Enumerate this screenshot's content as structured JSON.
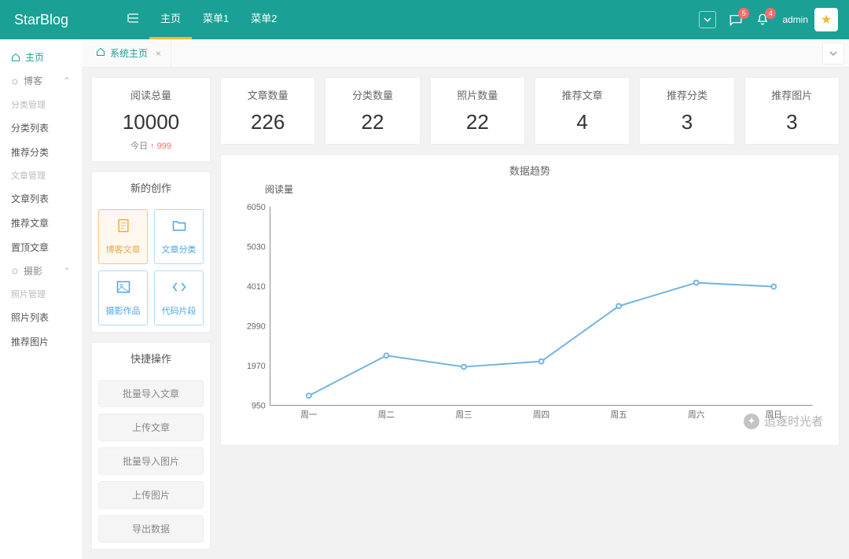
{
  "brand": "StarBlog",
  "top_menu": {
    "items": [
      "主页",
      "菜单1",
      "菜单2"
    ],
    "active": 0
  },
  "header": {
    "msg_badge": "5",
    "bell_badge": "4",
    "user": "admin"
  },
  "sidebar": {
    "home": "主页",
    "groups": [
      {
        "title": "博客",
        "sections": [
          {
            "subtitle": "分类管理",
            "items": [
              "分类列表",
              "推荐分类"
            ]
          },
          {
            "subtitle": "文章管理",
            "items": [
              "文章列表",
              "推荐文章",
              "置顶文章"
            ]
          }
        ]
      },
      {
        "title": "摄影",
        "sections": [
          {
            "subtitle": "照片管理",
            "items": [
              "照片列表",
              "推荐图片"
            ]
          }
        ]
      }
    ]
  },
  "tabs": {
    "items": [
      {
        "label": "系统主页"
      }
    ]
  },
  "stats": {
    "primary": {
      "label": "阅读总量",
      "value": "10000",
      "sub_prefix": "今日",
      "sub_value": "999"
    },
    "others": [
      {
        "label": "文章数量",
        "value": "226"
      },
      {
        "label": "分类数量",
        "value": "22"
      },
      {
        "label": "照片数量",
        "value": "22"
      },
      {
        "label": "推荐文章",
        "value": "4"
      },
      {
        "label": "推荐分类",
        "value": "3"
      },
      {
        "label": "推荐图片",
        "value": "3"
      }
    ]
  },
  "new_creation": {
    "title": "新的创作",
    "items": [
      {
        "label": "博客文章",
        "icon": "doc",
        "style": "orange"
      },
      {
        "label": "文章分类",
        "icon": "folder",
        "style": "blue"
      },
      {
        "label": "摄影作品",
        "icon": "image",
        "style": "blue"
      },
      {
        "label": "代码片段",
        "icon": "code",
        "style": "blue"
      }
    ]
  },
  "quick_actions": {
    "title": "快捷操作",
    "items": [
      "批量导入文章",
      "上传文章",
      "批量导入图片",
      "上传图片",
      "导出数据"
    ]
  },
  "chart_data": {
    "type": "line",
    "title": "数据趋势",
    "legend": "阅读量",
    "xlabel": "",
    "ylabel": "",
    "categories": [
      "周一",
      "周二",
      "周三",
      "周四",
      "周五",
      "周六",
      "周日"
    ],
    "values": [
      1200,
      2230,
      1940,
      2080,
      3500,
      4100,
      4000
    ],
    "yticks": [
      950,
      1970,
      2990,
      4010,
      5030,
      6050
    ],
    "ylim": [
      950,
      6050
    ]
  },
  "watermark": "追逐时光者"
}
